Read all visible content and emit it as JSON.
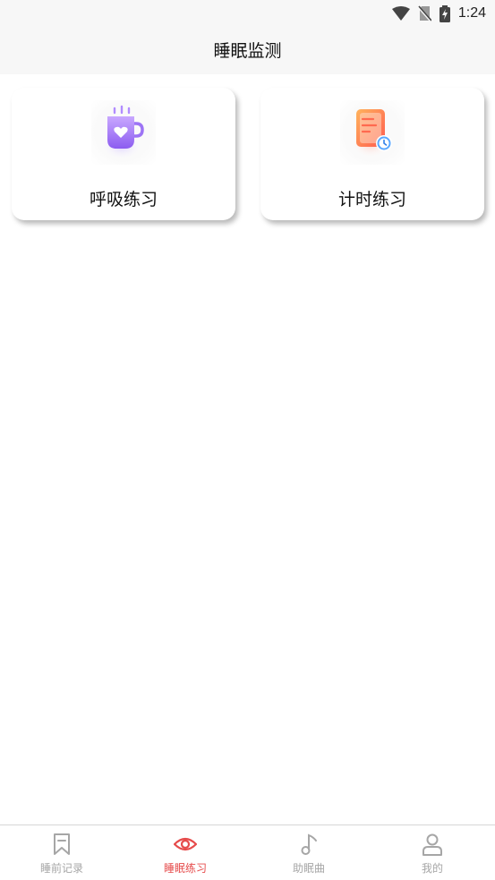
{
  "status_bar": {
    "time": "1:24",
    "icons": [
      "wifi-icon",
      "no-sim-icon",
      "battery-charging-icon"
    ]
  },
  "header": {
    "title": "睡眠监测"
  },
  "cards": [
    {
      "label": "呼吸练习",
      "icon": "coffee-cup-heart-icon"
    },
    {
      "label": "计时练习",
      "icon": "document-clock-icon"
    }
  ],
  "tabs": [
    {
      "label": "睡前记录",
      "icon": "bookmark-icon",
      "active": false
    },
    {
      "label": "睡眠练习",
      "icon": "eye-icon",
      "active": true
    },
    {
      "label": "助眠曲",
      "icon": "music-note-icon",
      "active": false
    },
    {
      "label": "我的",
      "icon": "person-icon",
      "active": false
    }
  ],
  "colors": {
    "accent": "#e64b4b",
    "inactive": "#a6a6a6",
    "header_bg": "#f7f7f7"
  }
}
